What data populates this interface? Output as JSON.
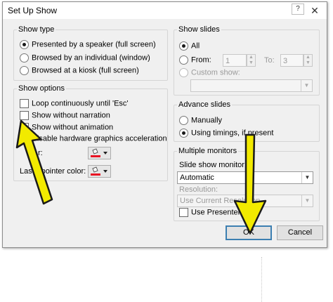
{
  "window": {
    "title": "Set Up Show",
    "help_label": "?",
    "close_label": "✕"
  },
  "show_type": {
    "legend": "Show type",
    "options": [
      {
        "label": "Presented by a speaker (full screen)",
        "selected": true
      },
      {
        "label": "Browsed by an individual (window)",
        "selected": false
      },
      {
        "label": "Browsed at a kiosk (full screen)",
        "selected": false
      }
    ]
  },
  "show_options": {
    "legend": "Show options",
    "checkboxes": [
      {
        "label": "Loop continuously until 'Esc'",
        "checked": false
      },
      {
        "label": "Show without narration",
        "checked": false
      },
      {
        "label": "Show without animation",
        "checked": true
      },
      {
        "label": "Disable hardware graphics acceleration",
        "checked": false
      }
    ],
    "pen_color_label": "r:",
    "laser_pointer_color_label": "Laser pointer color:",
    "pen_color": "#e81123",
    "laser_color": "#e81123"
  },
  "show_slides": {
    "legend": "Show slides",
    "all_label": "All",
    "from_label": "From:",
    "from_value": "1",
    "to_label": "To:",
    "to_value": "3",
    "custom_label": "Custom show:"
  },
  "advance_slides": {
    "legend": "Advance slides",
    "manually_label": "Manually",
    "timings_label": "Using timings, if present"
  },
  "multiple_monitors": {
    "legend": "Multiple monitors",
    "monitor_label": "Slide show monitor:",
    "monitor_value": "Automatic",
    "resolution_label": "Resolution:",
    "resolution_value": "Use Current Resolution",
    "presenter_view_label": "Use Presenter View"
  },
  "buttons": {
    "ok_label": "OK",
    "cancel_label": "Cancel"
  },
  "annotation_color": "#f2ea00"
}
